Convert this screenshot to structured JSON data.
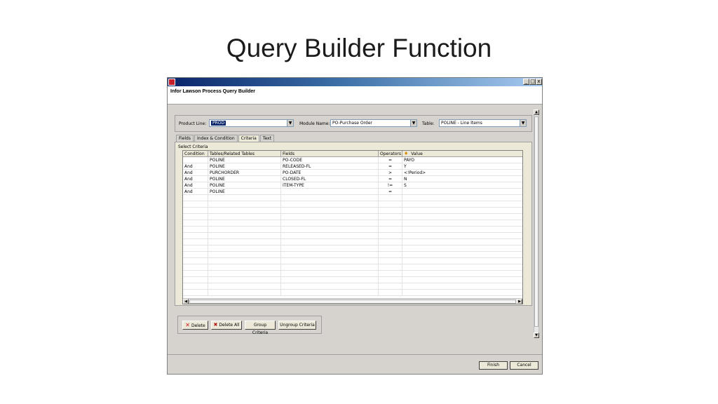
{
  "slide": {
    "title": "Query Builder Function"
  },
  "window": {
    "title": "Infor Lawson Process Query Builder",
    "controls": {
      "minimize": "_",
      "maximize": "□",
      "close": "x"
    }
  },
  "selectors": {
    "product_line": {
      "label": "Product Line:",
      "value": "PROD"
    },
    "module_name": {
      "label": "Module Name:",
      "value": "PO-Purchase Order"
    },
    "table": {
      "label": "Table:",
      "value": "POLINE - Line Items"
    }
  },
  "tabs": [
    {
      "label": "Fields"
    },
    {
      "label": "Index & Condition"
    },
    {
      "label": "Criteria",
      "active": true
    },
    {
      "label": "Text"
    }
  ],
  "criteria": {
    "group_label": "Select Criteria",
    "columns": [
      "Condition",
      "Tables/Related Tables",
      "Fields",
      "Operators",
      "Value"
    ],
    "rows": [
      {
        "condition": "",
        "table": "POLINE",
        "field": "PO-CODE",
        "operator": "=",
        "value": "PAYO"
      },
      {
        "condition": "And",
        "table": "POLINE",
        "field": "RELEASED-FL",
        "operator": "=",
        "value": "Y"
      },
      {
        "condition": "And",
        "table": "PURCHORDER",
        "field": "PO-DATE",
        "operator": ">",
        "value": "<!Period>"
      },
      {
        "condition": "And",
        "table": "POLINE",
        "field": "CLOSED-FL",
        "operator": "=",
        "value": "N"
      },
      {
        "condition": "And",
        "table": "POLINE",
        "field": "ITEM-TYPE",
        "operator": "!=",
        "value": "S"
      },
      {
        "condition": "And",
        "table": "POLINE",
        "field": "",
        "operator": "=",
        "value": ""
      }
    ]
  },
  "actions": {
    "delete": "Delete",
    "delete_all": "Delete All",
    "group_criteria": "Group Criteria",
    "ungroup_criteria": "Ungroup Criteria"
  },
  "footer": {
    "finish": "Finish",
    "cancel": "Cancel"
  },
  "icons": {
    "app": "app-logo-icon",
    "value_column": "key-icon",
    "delete": "x-icon",
    "delete_all": "delete-all-icon"
  },
  "colors": {
    "titlebar_start": "#0a246a",
    "titlebar_end": "#a6caf0",
    "selection": "#0a246a",
    "app_icon": "#c8202a"
  }
}
